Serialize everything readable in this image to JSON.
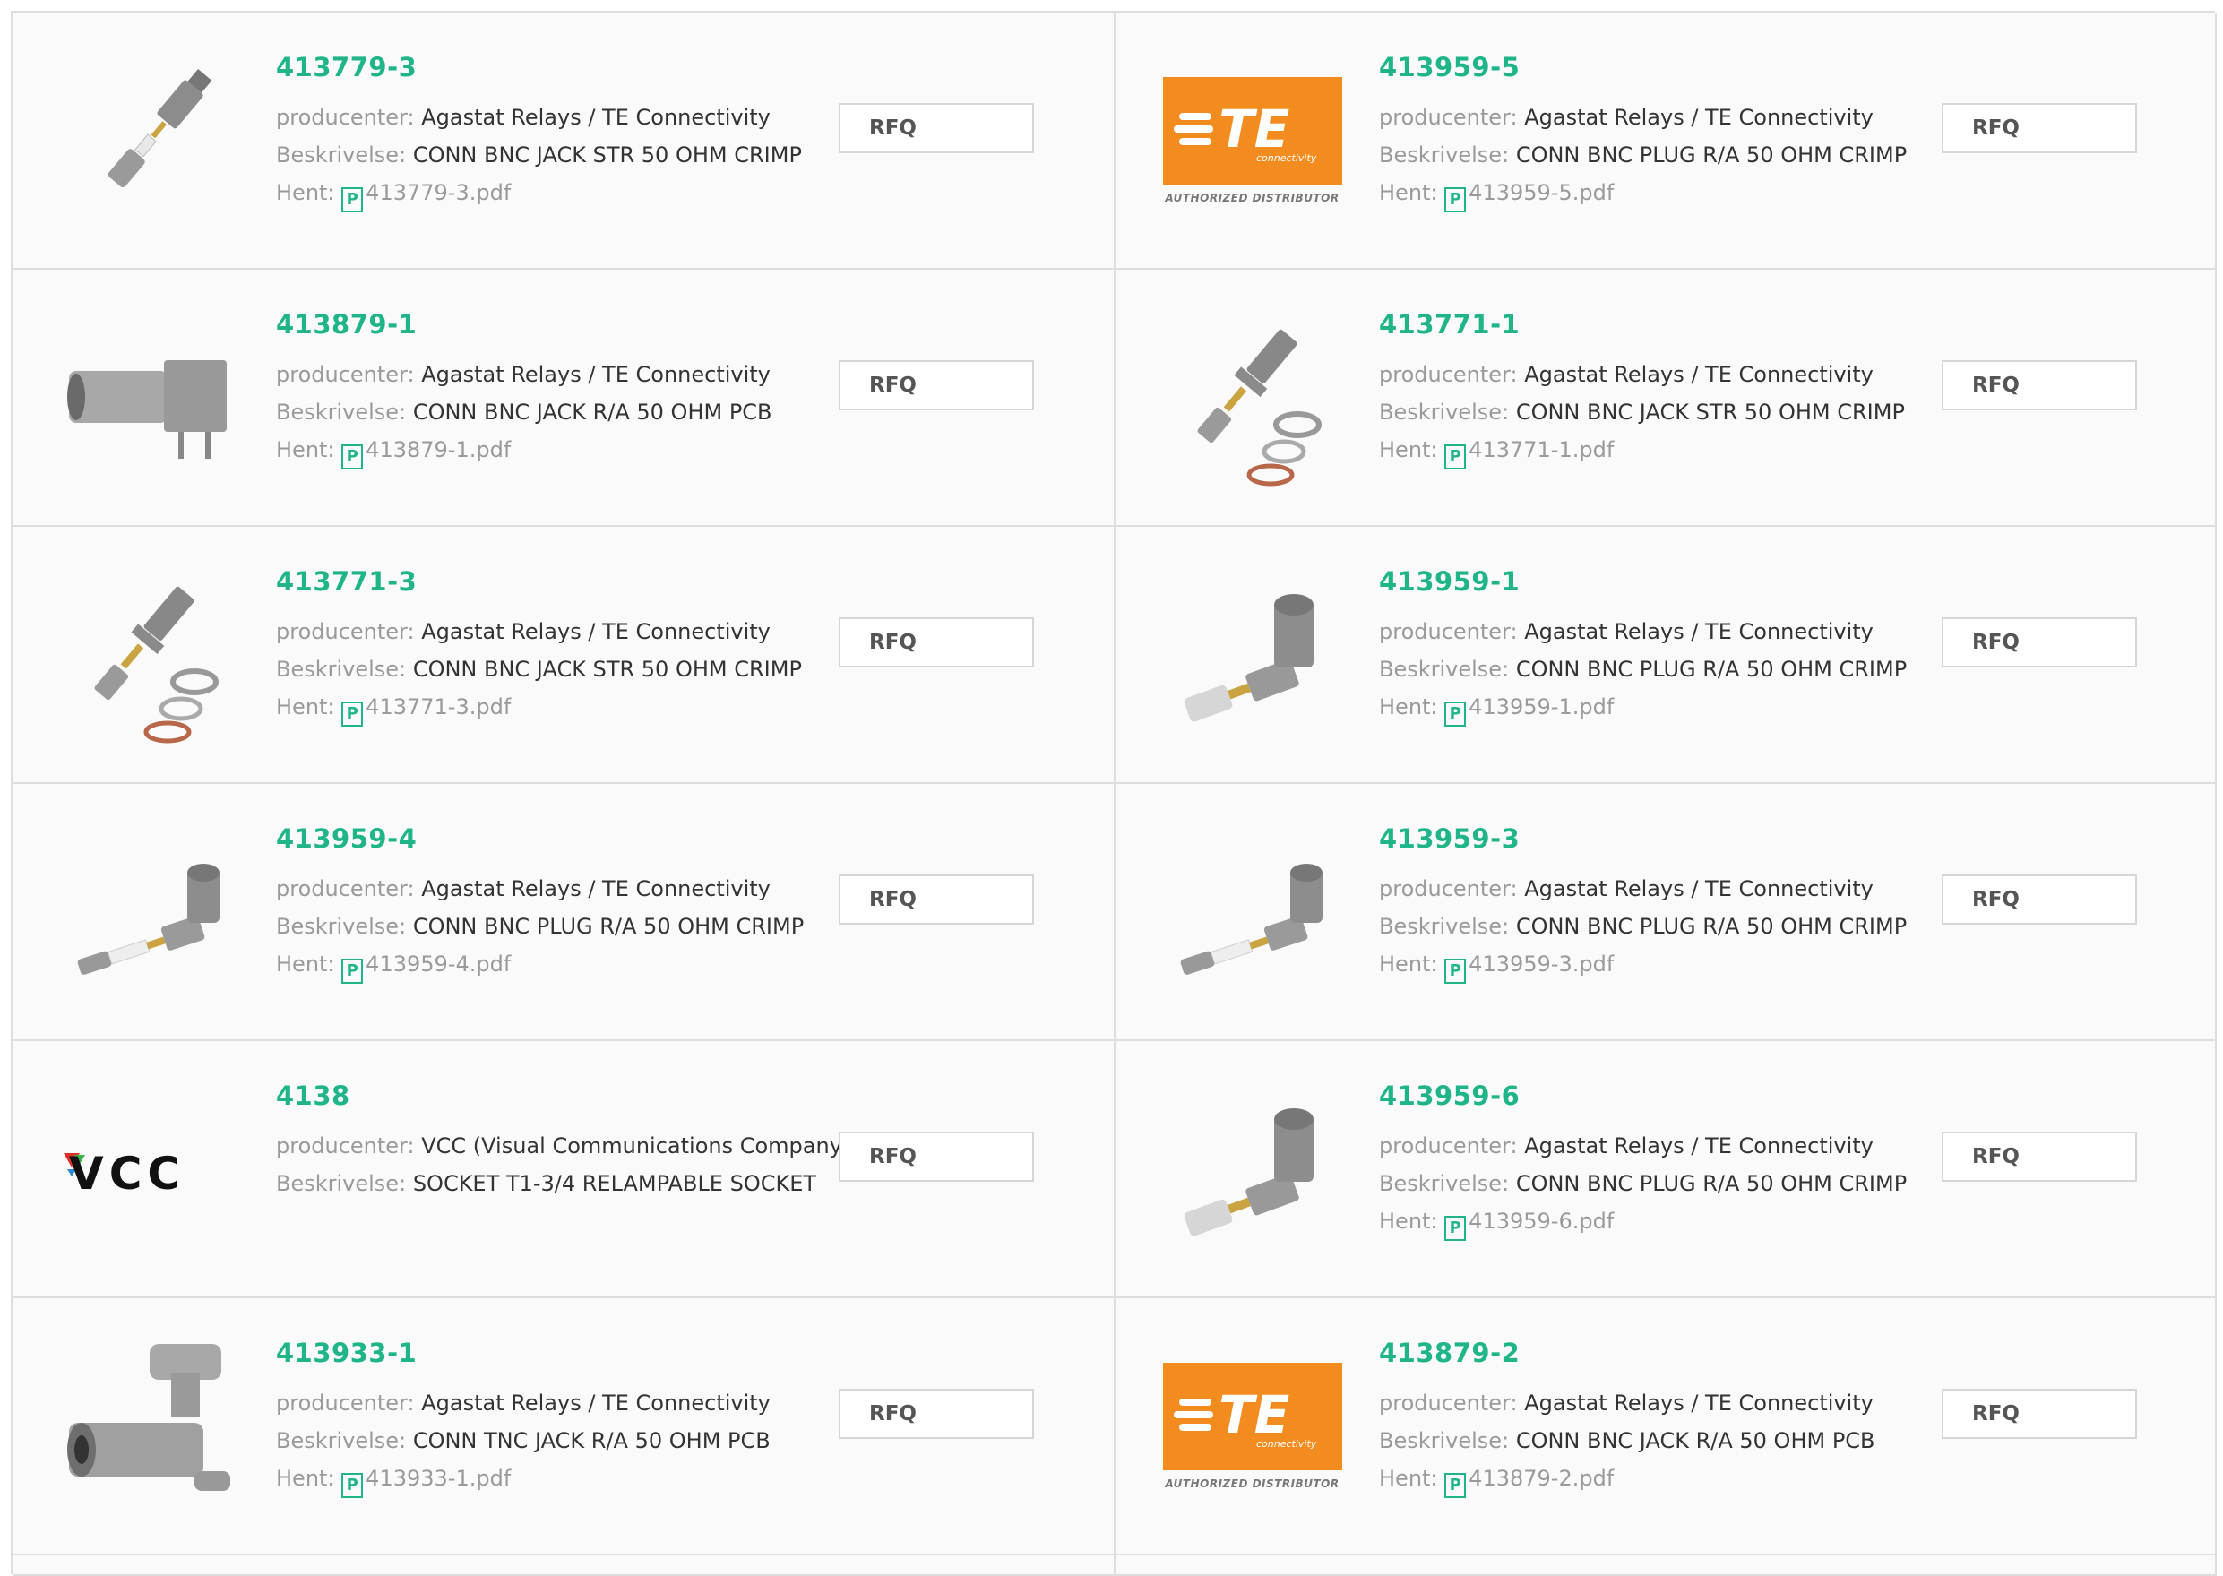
{
  "labels": {
    "producer": "producenter:",
    "description": "Beskrivelse:",
    "download": "Hent:",
    "rfq": "RFQ"
  },
  "te_logo": {
    "wordmark": "TE",
    "tagline": "connectivity",
    "sub": "AUTHORIZED DISTRIBUTOR"
  },
  "vcc_logo": {
    "wordmark": "VCC"
  },
  "colors": {
    "accent": "#1fb589",
    "te_orange": "#f28c1e",
    "border": "#dedede"
  },
  "products": [
    {
      "part": "413779-3",
      "producer": "Agastat Relays / TE Connectivity",
      "description": "CONN BNC JACK STR 50 OHM CRIMP",
      "pdf": "413779-3.pdf",
      "image": "bnc-straight-crimp"
    },
    {
      "part": "413959-5",
      "producer": "Agastat Relays / TE Connectivity",
      "description": "CONN BNC PLUG R/A 50 OHM CRIMP",
      "pdf": "413959-5.pdf",
      "image": "te-logo"
    },
    {
      "part": "413879-1",
      "producer": "Agastat Relays / TE Connectivity",
      "description": "CONN BNC JACK R/A 50 OHM PCB",
      "pdf": "413879-1.pdf",
      "image": "bnc-ra-pcb"
    },
    {
      "part": "413771-1",
      "producer": "Agastat Relays / TE Connectivity",
      "description": "CONN BNC JACK STR 50 OHM CRIMP",
      "pdf": "413771-1.pdf",
      "image": "bnc-bulkhead-kit"
    },
    {
      "part": "413771-3",
      "producer": "Agastat Relays / TE Connectivity",
      "description": "CONN BNC JACK STR 50 OHM CRIMP",
      "pdf": "413771-3.pdf",
      "image": "bnc-bulkhead-kit"
    },
    {
      "part": "413959-1",
      "producer": "Agastat Relays / TE Connectivity",
      "description": "CONN BNC PLUG R/A 50 OHM CRIMP",
      "pdf": "413959-1.pdf",
      "image": "bnc-ra-plug"
    },
    {
      "part": "413959-4",
      "producer": "Agastat Relays / TE Connectivity",
      "description": "CONN BNC PLUG R/A 50 OHM CRIMP",
      "pdf": "413959-4.pdf",
      "image": "bnc-ra-plug-long"
    },
    {
      "part": "413959-3",
      "producer": "Agastat Relays / TE Connectivity",
      "description": "CONN BNC PLUG R/A 50 OHM CRIMP",
      "pdf": "413959-3.pdf",
      "image": "bnc-ra-plug-long"
    },
    {
      "part": "4138",
      "producer": "VCC (Visual Communications Company)",
      "description": "SOCKET T1-3/4 RELAMPABLE SOCKET",
      "pdf": null,
      "image": "vcc-logo"
    },
    {
      "part": "413959-6",
      "producer": "Agastat Relays / TE Connectivity",
      "description": "CONN BNC PLUG R/A 50 OHM CRIMP",
      "pdf": "413959-6.pdf",
      "image": "bnc-ra-plug"
    },
    {
      "part": "413933-1",
      "producer": "Agastat Relays / TE Connectivity",
      "description": "CONN TNC JACK R/A 50 OHM PCB",
      "pdf": "413933-1.pdf",
      "image": "tnc-ra-pcb"
    },
    {
      "part": "413879-2",
      "producer": "Agastat Relays / TE Connectivity",
      "description": "CONN BNC JACK R/A 50 OHM PCB",
      "pdf": "413879-2.pdf",
      "image": "te-logo"
    }
  ]
}
